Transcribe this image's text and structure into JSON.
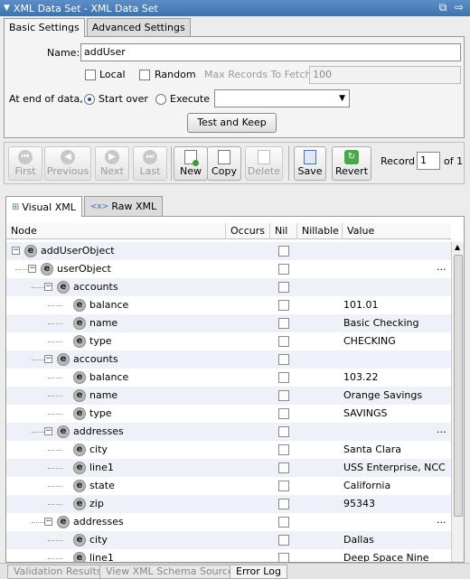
{
  "window": {
    "title": "XML Data Set - XML Data Set"
  },
  "tabs": [
    "Basic Settings",
    "Advanced Settings"
  ],
  "basic": {
    "name_label": "Name:",
    "name_value": "addUser",
    "local_label": "Local",
    "random_label": "Random",
    "max_records_label": "Max Records To Fetch:",
    "max_records_value": "100",
    "end_label": "At end of data,",
    "start_over_label": "Start over",
    "execute_label": "Execute",
    "test_keep_label": "Test and Keep"
  },
  "toolbar": {
    "first": "First",
    "previous": "Previous",
    "next": "Next",
    "last": "Last",
    "new": "New",
    "copy": "Copy",
    "delete": "Delete",
    "save": "Save",
    "revert": "Revert",
    "record_label": "Record",
    "record_value": "1",
    "of_label": "of 1"
  },
  "view_tabs": [
    "Visual XML",
    "Raw XML"
  ],
  "tree": {
    "columns": [
      "Node",
      "Occurs",
      "Nil",
      "Nillable",
      "Value"
    ],
    "rows": [
      {
        "depth": 0,
        "name": "addUserObject",
        "value": "",
        "expandable": true,
        "ellipsis": false
      },
      {
        "depth": 1,
        "name": "userObject",
        "value": "",
        "expandable": true,
        "ellipsis": true
      },
      {
        "depth": 2,
        "name": "accounts",
        "value": "",
        "expandable": true,
        "ellipsis": false
      },
      {
        "depth": 3,
        "name": "balance",
        "value": "101.01",
        "expandable": false,
        "ellipsis": false
      },
      {
        "depth": 3,
        "name": "name",
        "value": "Basic Checking",
        "expandable": false,
        "ellipsis": false
      },
      {
        "depth": 3,
        "name": "type",
        "value": "CHECKING",
        "expandable": false,
        "ellipsis": false
      },
      {
        "depth": 2,
        "name": "accounts",
        "value": "",
        "expandable": true,
        "ellipsis": false
      },
      {
        "depth": 3,
        "name": "balance",
        "value": "103.22",
        "expandable": false,
        "ellipsis": false
      },
      {
        "depth": 3,
        "name": "name",
        "value": "Orange Savings",
        "expandable": false,
        "ellipsis": false
      },
      {
        "depth": 3,
        "name": "type",
        "value": "SAVINGS",
        "expandable": false,
        "ellipsis": false
      },
      {
        "depth": 2,
        "name": "addresses",
        "value": "",
        "expandable": true,
        "ellipsis": true
      },
      {
        "depth": 3,
        "name": "city",
        "value": "Santa Clara",
        "expandable": false,
        "ellipsis": false
      },
      {
        "depth": 3,
        "name": "line1",
        "value": "USS Enterprise, NCC",
        "expandable": false,
        "ellipsis": false
      },
      {
        "depth": 3,
        "name": "state",
        "value": "California",
        "expandable": false,
        "ellipsis": false
      },
      {
        "depth": 3,
        "name": "zip",
        "value": "95343",
        "expandable": false,
        "ellipsis": false
      },
      {
        "depth": 2,
        "name": "addresses",
        "value": "",
        "expandable": true,
        "ellipsis": true
      },
      {
        "depth": 3,
        "name": "city",
        "value": "Dallas",
        "expandable": false,
        "ellipsis": false
      },
      {
        "depth": 3,
        "name": "line1",
        "value": "Deep Space Nine",
        "expandable": false,
        "ellipsis": false
      }
    ]
  },
  "status_tabs": [
    "Validation Results",
    "View XML Schema Source",
    "Error Log"
  ],
  "icons": {
    "element": "e",
    "raw_xml": "<x>"
  }
}
